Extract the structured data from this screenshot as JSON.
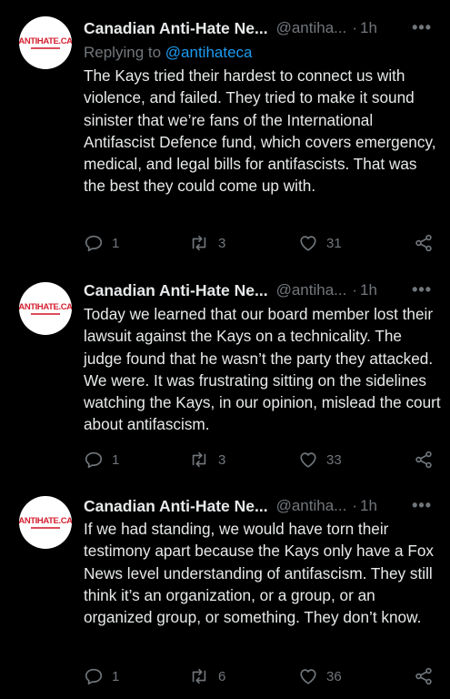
{
  "tweets": [
    {
      "avatar_text": "ANTIHATE.CA",
      "name": "Canadian Anti-Hate Ne...",
      "handle": "@antiha...",
      "dot": "·",
      "time": "1h",
      "more": "•••",
      "reply_prefix": "Replying to ",
      "reply_mention": "@antihateca",
      "body": "The Kays tried their hardest to connect us with violence, and failed. They tried to make it sound sinister that we’re fans of the International Antifascist Defence fund, which covers emergency, medical, and legal bills for antifascists. That was the best they could come up with.",
      "replies": "1",
      "retweets": "3",
      "likes": "31"
    },
    {
      "avatar_text": "ANTIHATE.CA",
      "name": "Canadian Anti-Hate Ne...",
      "handle": "@antiha...",
      "dot": "·",
      "time": "1h",
      "more": "•••",
      "body": "Today we learned that our board member lost their lawsuit against the Kays on a technicality. The judge found that he wasn’t the party they attacked. We were. It was frustrating sitting on the sidelines watching the Kays, in our opinion, mislead the court about antifascism.",
      "replies": "1",
      "retweets": "3",
      "likes": "33"
    },
    {
      "avatar_text": "ANTIHATE.CA",
      "name": "Canadian Anti-Hate Ne...",
      "handle": "@antiha...",
      "dot": "·",
      "time": "1h",
      "more": "•••",
      "body": "If we had standing, we would have torn their testimony apart because the Kays only have a Fox News level understanding of antifascism. They still think it’s an organization, or a group, or an organized group, or something. They don’t know.",
      "replies": "1",
      "retweets": "6",
      "likes": "36"
    }
  ],
  "colors": {
    "background": "#000000",
    "text": "#e7e9ea",
    "muted": "#71767b",
    "mention": "#1d9bf0",
    "logo_red": "#d32030"
  },
  "icons": {
    "reply": "reply-icon",
    "retweet": "retweet-icon",
    "like": "heart-icon",
    "share": "share-icon",
    "more": "more-icon"
  }
}
